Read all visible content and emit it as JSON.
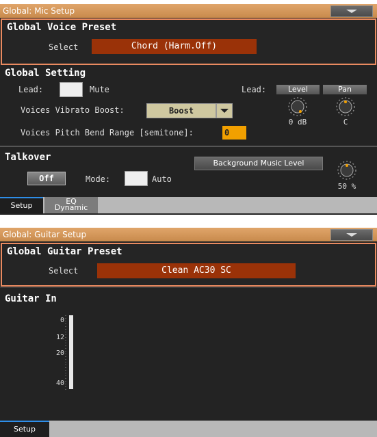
{
  "mic_setup": {
    "title": "Global: Mic Setup",
    "voice_preset": {
      "heading": "Global Voice Preset",
      "select_label": "Select",
      "select_value": "Chord (Harm.Off)"
    },
    "global_setting": {
      "heading": "Global Setting",
      "lead_label": "Lead:",
      "mute_label": "Mute",
      "mute_checked": false,
      "vibrato_label": "Voices Vibrato Boost:",
      "vibrato_value": "Boost",
      "pitch_bend_label": "Voices Pitch Bend Range [semitone]:",
      "pitch_bend_value": "0",
      "lead_label_right": "Lead:",
      "level_label": "Level",
      "level_value": "0 dB",
      "pan_label": "Pan",
      "pan_value": "C"
    },
    "talkover": {
      "heading": "Talkover",
      "off_label": "Off",
      "mode_label": "Mode:",
      "auto_label": "Auto",
      "auto_checked": false,
      "bg_level_label": "Background Music Level",
      "bg_level_value": "50 %"
    },
    "tabs": [
      {
        "label": "Setup",
        "active": true
      },
      {
        "label": "EQ\nDynamic",
        "active": false
      }
    ]
  },
  "guitar_setup": {
    "title": "Global: Guitar Setup",
    "guitar_preset": {
      "heading": "Global Guitar Preset",
      "select_label": "Select",
      "select_value": "Clean AC30 SC"
    },
    "guitar_in": {
      "heading": "Guitar In",
      "meter_ticks": [
        "0",
        "12",
        "20",
        "40"
      ]
    },
    "tabs": [
      {
        "label": "Setup",
        "active": true
      }
    ]
  },
  "colors": {
    "title_bar": "#d89a5c",
    "preset_border": "#ea8a60",
    "select_bg": "#9a3208",
    "pitch_field": "#f2a000",
    "active_tab_accent": "#2e8ee8"
  }
}
